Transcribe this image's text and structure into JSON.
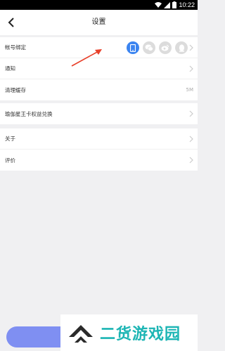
{
  "status_bar": {
    "time": "10:22"
  },
  "nav": {
    "title": "设置"
  },
  "settings": {
    "account_binding": {
      "label": "帐号绑定",
      "icons": [
        "phone-icon",
        "wechat-icon",
        "weibo-icon",
        "qq-icon"
      ]
    },
    "notifications": {
      "label": "通知"
    },
    "clear_cache": {
      "label": "清理缓存",
      "value": "5M"
    },
    "redeem": {
      "label": "瑜伽星王卡权益兑换"
    },
    "about": {
      "label": "关于"
    },
    "rate": {
      "label": "评价"
    }
  },
  "colors": {
    "accent": "#3b84f0",
    "button": "#7f8ff2",
    "annotation_arrow": "#e8402a",
    "watermark": "#1cb5b4"
  },
  "watermark": {
    "text": "二货游戏园"
  }
}
